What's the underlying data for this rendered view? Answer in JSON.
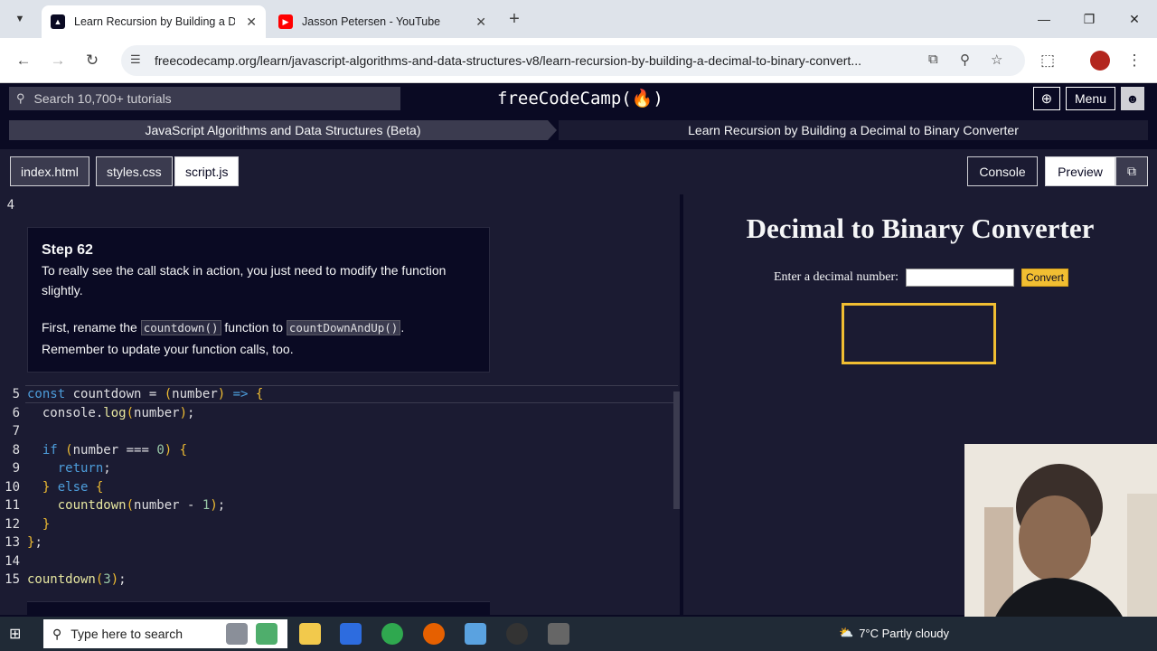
{
  "browser": {
    "tabs": [
      {
        "title": "Learn Recursion by Building a De",
        "favicon": "freecodecamp-icon"
      },
      {
        "title": "Jasson Petersen - YouTube",
        "favicon": "youtube-icon"
      }
    ],
    "url": "freecodecamp.org/learn/javascript-algorithms-and-data-structures-v8/learn-recursion-by-building-a-decimal-to-binary-convert..."
  },
  "fcc": {
    "search_placeholder": "Search 10,700+ tutorials",
    "logo": "freeCodeCamp(🔥)",
    "menu_label": "Menu"
  },
  "breadcrumbs": {
    "superblock": "JavaScript Algorithms and Data Structures (Beta)",
    "block": "Learn Recursion by Building a Decimal to Binary Converter"
  },
  "file_tabs": [
    "index.html",
    "styles.css",
    "script.js"
  ],
  "active_file": "script.js",
  "panel_buttons": {
    "console": "Console",
    "preview": "Preview"
  },
  "editor": {
    "first_line_number": "4",
    "step_title": "Step 62",
    "step_text_1": "To really see the call stack in action, you just need to modify the function slightly.",
    "step_text_2a": "First, rename the",
    "step_code_1": "countdown()",
    "step_text_2b": "function to",
    "step_code_2": "countDownAndUp()",
    "step_text_2c": ".",
    "step_text_3": "Remember to update your function calls, too.",
    "line_numbers": [
      "5",
      "6",
      "7",
      "8",
      "9",
      "10",
      "11",
      "12",
      "13",
      "14",
      "15"
    ]
  },
  "preview": {
    "title": "Decimal to Binary Converter",
    "label": "Enter a decimal number:",
    "button": "Convert"
  },
  "taskbar": {
    "search_placeholder": "Type here to search",
    "weather": "7°C  Partly cloudy"
  },
  "colors": {
    "fcc_bg": "#0a0a23",
    "editor_bg": "#1b1b32",
    "accent_yellow": "#f1be32"
  }
}
